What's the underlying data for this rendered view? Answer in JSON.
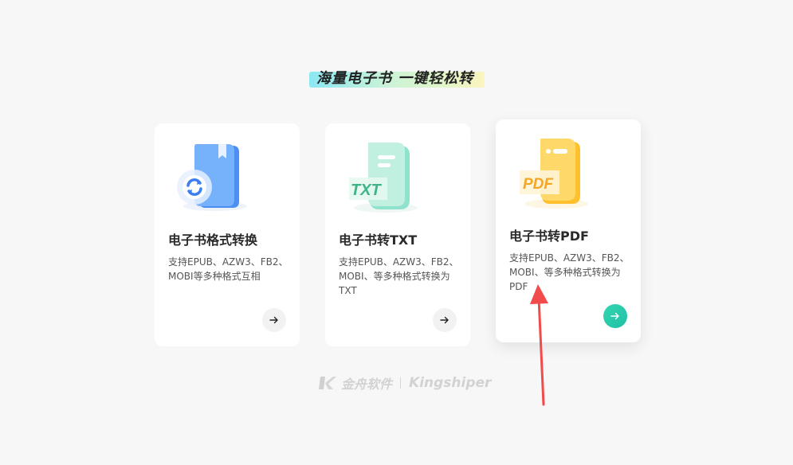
{
  "headline": "海量电子书  一键轻松转",
  "cards": [
    {
      "title": "电子书格式转换",
      "desc": "支持EPUB、AZW3、FB2、MOBI等多种格式互相",
      "icon": "book-convert-icon",
      "accent": "#5aa2f8"
    },
    {
      "title": "电子书转TXT",
      "desc": "支持EPUB、AZW3、FB2、MOBI、等多种格式转换为TXT",
      "icon": "txt-file-icon",
      "icon_text": "TXT",
      "accent": "#7fdcc2"
    },
    {
      "title": "电子书转PDF",
      "desc": "支持EPUB、AZW3、FB2、MOBI、等多种格式转换为PDF",
      "icon": "pdf-file-icon",
      "icon_text": "PDF",
      "accent": "#ffc83d"
    }
  ],
  "arrow_icon": "arrow-right-icon",
  "active_accent": "#2ccfae",
  "brand": {
    "logo": "kingshiper-logo-icon",
    "name_cn": "金舟软件",
    "name_en": "Kingshiper"
  },
  "annotation": {
    "type": "red-arrow",
    "color": "#f24b4b"
  }
}
